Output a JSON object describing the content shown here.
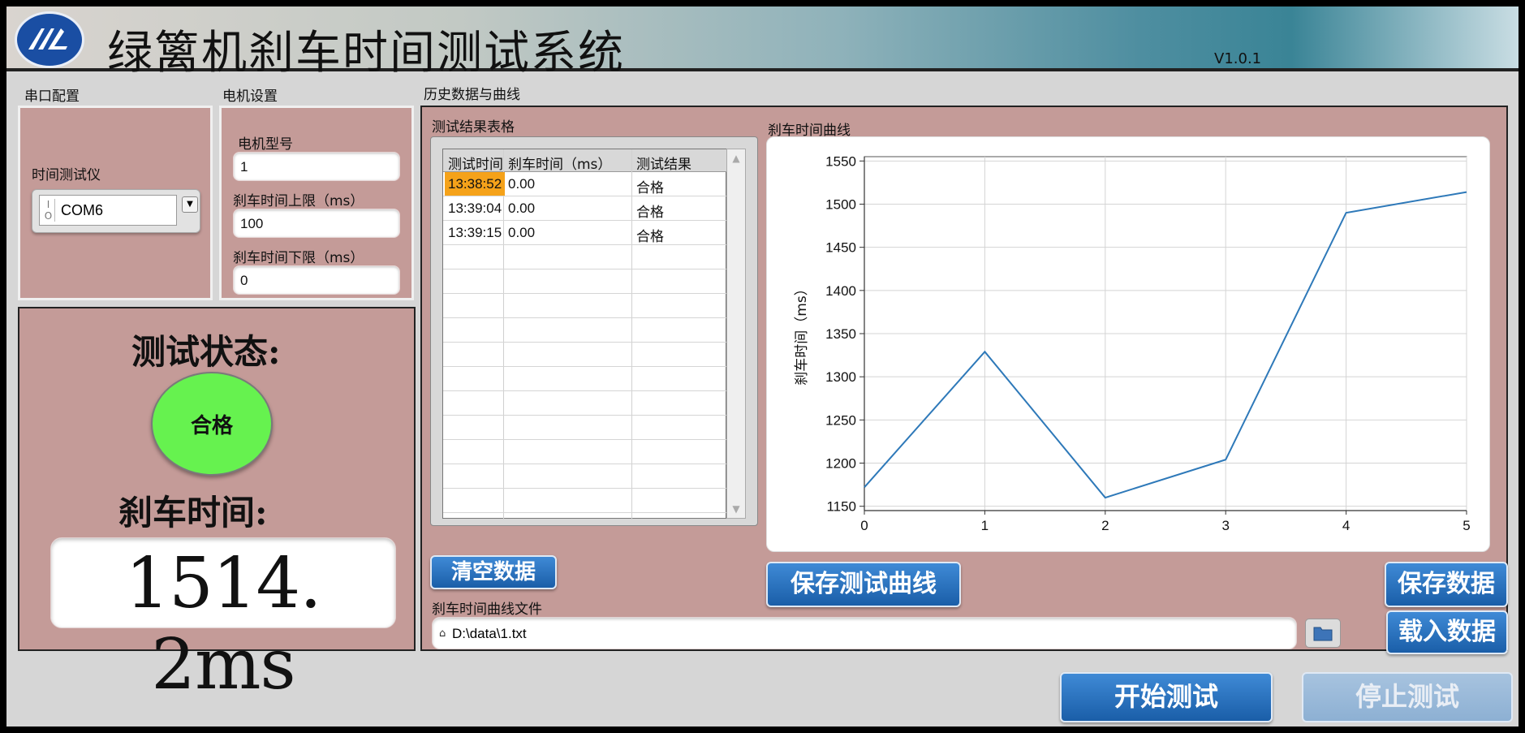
{
  "app": {
    "title": "绿篱机刹车时间测试系统",
    "version": "V1.0.1"
  },
  "serial": {
    "section_label": "串口配置",
    "device_label": "时间测试仪",
    "port_value": "COM6"
  },
  "motor": {
    "section_label": "电机设置",
    "model_label": "电机型号",
    "model_value": "1",
    "upper_label": "刹车时间上限（ms）",
    "upper_value": "100",
    "lower_label": "刹车时间下限（ms）",
    "lower_value": "0"
  },
  "status": {
    "state_title": "测试状态:",
    "indicator_text": "合格",
    "indicator_color": "#66f24f",
    "brake_title": "刹车时间:",
    "brake_value": "1514. 2ms"
  },
  "history": {
    "section_label": "历史数据与曲线",
    "table_label": "测试结果表格",
    "columns": [
      "测试时间",
      "刹车时间（ms）",
      "测试结果"
    ],
    "rows": [
      [
        "13:38:52",
        "0.00",
        "合格"
      ],
      [
        "13:39:04",
        "0.00",
        "合格"
      ],
      [
        "13:39:15",
        "0.00",
        "合格"
      ]
    ],
    "highlight_color": "#f5a21a",
    "chart_label": "刹车时间曲线",
    "clear_button": "清空数据",
    "save_curve_button": "保存测试曲线",
    "save_data_button": "保存数据",
    "load_data_button": "载入数据",
    "file_label": "刹车时间曲线文件",
    "file_path": "D:\\data\\1.txt"
  },
  "controls": {
    "start_button": "开始测试",
    "stop_button": "停止测试"
  },
  "chart_data": {
    "type": "line",
    "x": [
      0,
      1,
      2,
      3,
      4,
      5
    ],
    "y": [
      1172,
      1329,
      1160,
      1204,
      1490,
      1514
    ],
    "ylabel": "刹车时间（ms）",
    "xlabel": "",
    "xlim": [
      0,
      5
    ],
    "ylim": [
      1145,
      1555
    ],
    "yticks": [
      1150,
      1200,
      1250,
      1300,
      1350,
      1400,
      1450,
      1500,
      1550
    ],
    "xticks": [
      0,
      1,
      2,
      3,
      4,
      5
    ],
    "grid": true,
    "line_color": "#2e79b9"
  }
}
